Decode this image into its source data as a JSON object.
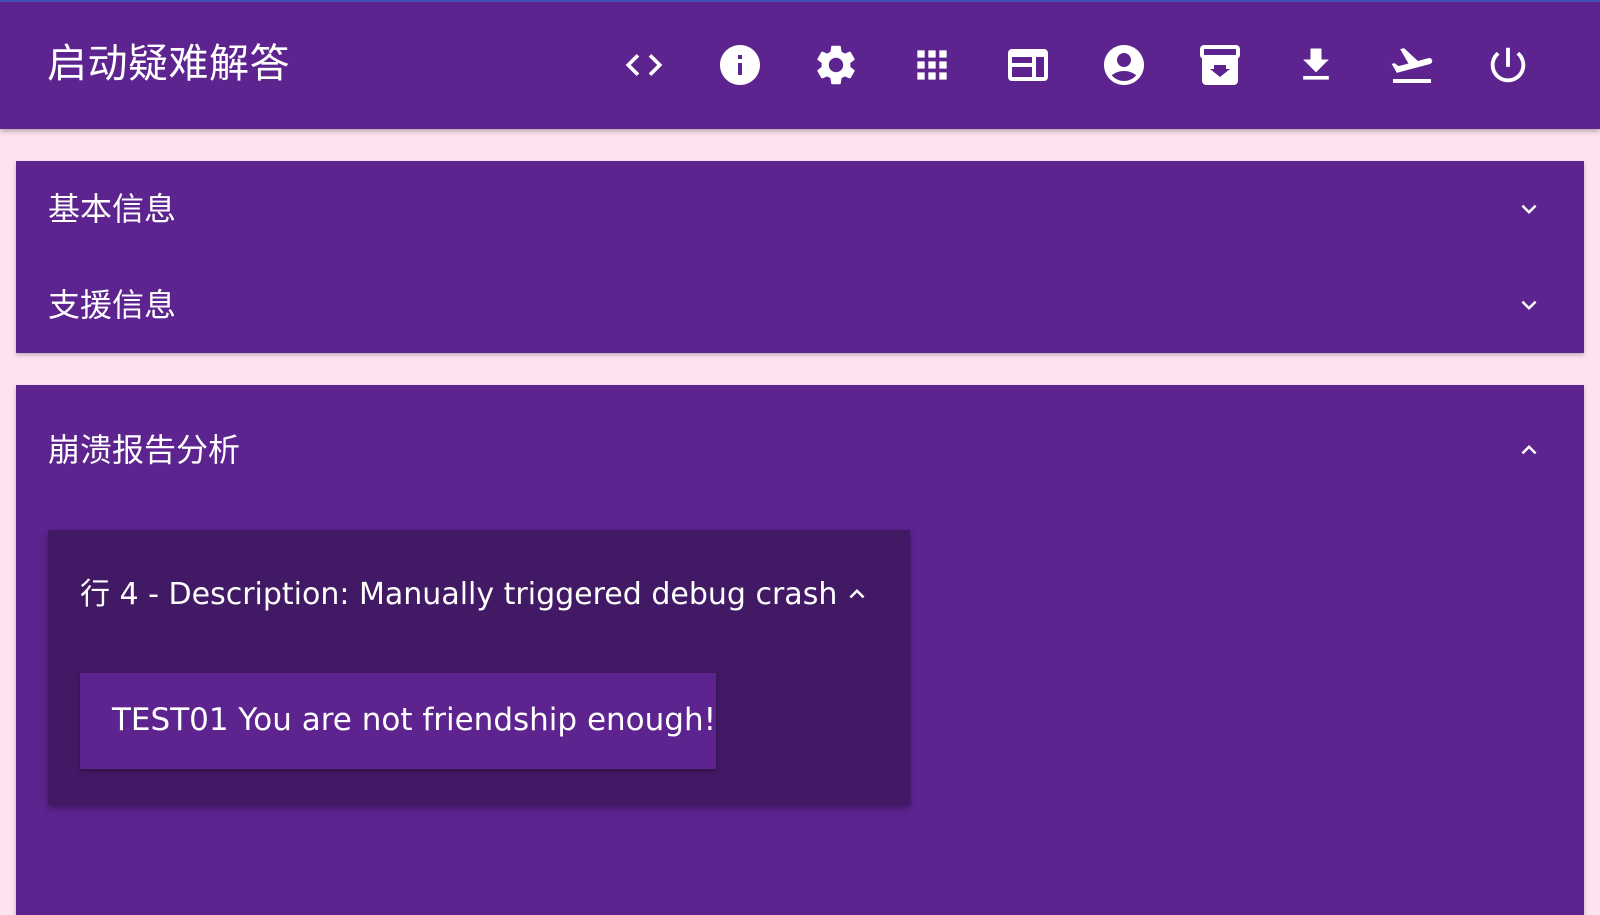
{
  "app": {
    "title": "启动疑难解答"
  },
  "toolbar": {
    "icons": [
      "code-icon",
      "info-icon",
      "settings-gear-icon",
      "apps-grid-icon",
      "web-panel-icon",
      "account-circle-icon",
      "inbox-icon",
      "download-icon",
      "flight-takeoff-icon",
      "power-icon"
    ]
  },
  "sections": {
    "basic_info": {
      "label": "基本信息",
      "expanded": false
    },
    "support_info": {
      "label": "支援信息",
      "expanded": false
    },
    "crash_analysis": {
      "label": "崩溃报告分析",
      "expanded": true,
      "entry": {
        "label": "行 4 - Description: Manually triggered debug crash",
        "expanded": true,
        "detail": "TEST01 You are not friendship enough!"
      }
    }
  },
  "colors": {
    "appbar": "#5d238f",
    "panel": "#5d238f",
    "inner_card": "#421964",
    "page_background": "#fde3f0",
    "text": "#ffffff"
  }
}
